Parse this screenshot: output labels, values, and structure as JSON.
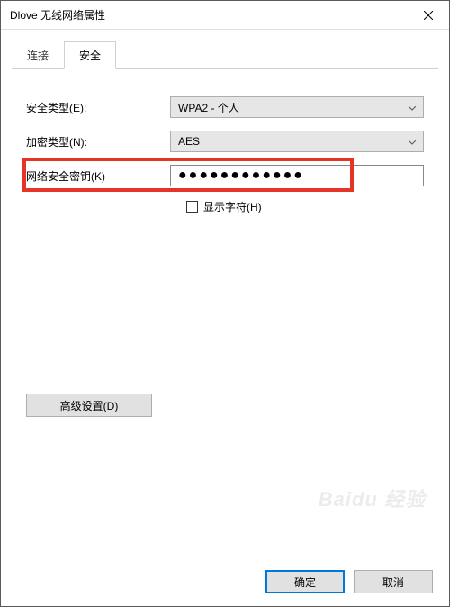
{
  "window": {
    "title": "Dlove 无线网络属性"
  },
  "tabs": {
    "connect": "连接",
    "security": "安全"
  },
  "form": {
    "security_type_label": "安全类型(E):",
    "security_type_value": "WPA2 - 个人",
    "encryption_label": "加密类型(N):",
    "encryption_value": "AES",
    "key_label": "网络安全密钥(K)",
    "key_value": "●●●●●●●●●●●●",
    "show_chars_label": "显示字符(H)"
  },
  "buttons": {
    "advanced": "高级设置(D)",
    "ok": "确定",
    "cancel": "取消"
  },
  "watermark": "Baidu 经验"
}
